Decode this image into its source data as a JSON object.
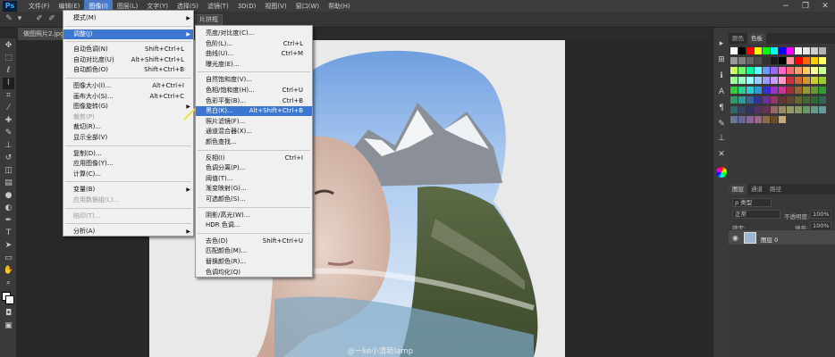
{
  "app": {
    "logo": "Ps",
    "menus": [
      "文件(F)",
      "编辑(E)",
      "图像(I)",
      "图层(L)",
      "文字(Y)",
      "选择(S)",
      "滤镜(T)",
      "3D(D)",
      "视图(V)",
      "窗口(W)",
      "帮助(H)"
    ],
    "win_controls": [
      "−",
      "❐",
      "✕"
    ]
  },
  "options": {
    "fragment": "片拼框"
  },
  "document": {
    "tab": "做图照片2.jpg @",
    "close": "×"
  },
  "watermark": "@一ke小清新lamp",
  "panels": {
    "top_tabs": [
      "颜色",
      "色板"
    ],
    "layer_tabs": [
      "图层",
      "通道",
      "路径"
    ],
    "kind": "ρ 类型",
    "blend": "正常",
    "opacity_label": "不透明度:",
    "opacity": "100%",
    "lock_label": "锁定:",
    "fill_label": "填充:",
    "fill": "100%",
    "layer_name": "图层 0"
  },
  "image_menu": [
    {
      "label": "模式(M)",
      "arrow": true
    },
    {
      "sep": true
    },
    {
      "label": "调整(J)",
      "arrow": true,
      "highlight": true
    },
    {
      "sep": true
    },
    {
      "label": "自动色调(N)",
      "shortcut": "Shift+Ctrl+L"
    },
    {
      "label": "自动对比度(U)",
      "shortcut": "Alt+Shift+Ctrl+L"
    },
    {
      "label": "自动颜色(O)",
      "shortcut": "Shift+Ctrl+B"
    },
    {
      "sep": true
    },
    {
      "label": "图像大小(I)...",
      "shortcut": "Alt+Ctrl+I"
    },
    {
      "label": "画布大小(S)...",
      "shortcut": "Alt+Ctrl+C"
    },
    {
      "label": "图像旋转(G)",
      "arrow": true
    },
    {
      "label": "裁剪(P)",
      "disabled": true
    },
    {
      "label": "裁切(R)..."
    },
    {
      "label": "显示全部(V)"
    },
    {
      "sep": true
    },
    {
      "label": "复制(D)..."
    },
    {
      "label": "应用图像(Y)..."
    },
    {
      "label": "计算(C)..."
    },
    {
      "sep": true
    },
    {
      "label": "变量(B)",
      "arrow": true
    },
    {
      "label": "应用数据组(L)...",
      "disabled": true
    },
    {
      "sep": true
    },
    {
      "label": "陷印(T)...",
      "disabled": true
    },
    {
      "sep": true
    },
    {
      "label": "分析(A)",
      "arrow": true
    }
  ],
  "adjust_menu": [
    {
      "label": "亮度/对比度(C)..."
    },
    {
      "label": "色阶(L)...",
      "shortcut": "Ctrl+L"
    },
    {
      "label": "曲线(U)...",
      "shortcut": "Ctrl+M"
    },
    {
      "label": "曝光度(E)..."
    },
    {
      "sep": true
    },
    {
      "label": "自然饱和度(V)..."
    },
    {
      "label": "色相/饱和度(H)...",
      "shortcut": "Ctrl+U"
    },
    {
      "label": "色彩平衡(B)...",
      "shortcut": "Ctrl+B"
    },
    {
      "label": "黑白(K)...",
      "shortcut": "Alt+Shift+Ctrl+B",
      "highlight": true
    },
    {
      "label": "照片滤镜(F)..."
    },
    {
      "label": "通道混合器(X)..."
    },
    {
      "label": "颜色查找..."
    },
    {
      "sep": true
    },
    {
      "label": "反相(I)",
      "shortcut": "Ctrl+I"
    },
    {
      "label": "色调分离(P)..."
    },
    {
      "label": "阈值(T)..."
    },
    {
      "label": "渐变映射(G)..."
    },
    {
      "label": "可选颜色(S)..."
    },
    {
      "sep": true
    },
    {
      "label": "阴影/高光(W)..."
    },
    {
      "label": "HDR 色调..."
    },
    {
      "sep": true
    },
    {
      "label": "去色(D)",
      "shortcut": "Shift+Ctrl+U"
    },
    {
      "label": "匹配颜色(M)..."
    },
    {
      "label": "替换颜色(R)..."
    },
    {
      "label": "色调均化(Q)"
    }
  ]
}
